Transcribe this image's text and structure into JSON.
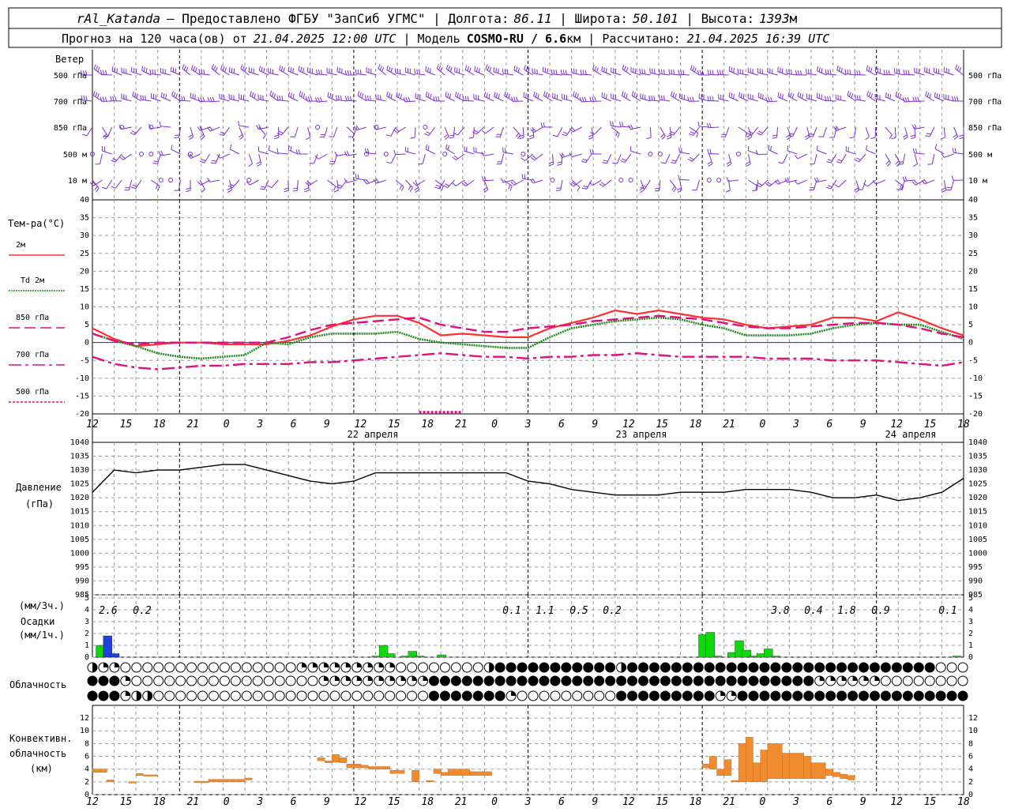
{
  "header": {
    "station": "rAl_Katanda",
    "provider": "— Предоставлено ФГБУ \"ЗапСиб УГМС\"",
    "lon_label": "Долгота:",
    "lon_value": "86.11",
    "lat_label": "Широта:",
    "lat_value": "50.101",
    "alt_label": "Высота:",
    "alt_value": "1393",
    "alt_unit": "м",
    "fc_label": "Прогноз на 120 часа(ов) от",
    "fc_value": "21.04.2025 12:00 UTC",
    "model_label": "Модель",
    "model_value": "COSMO-RU / 6.6",
    "model_unit": "км",
    "calc_label": "Рассчитано:",
    "calc_value": "21.04.2025 16:39 UTC"
  },
  "time_axis": {
    "hours": [
      "12",
      "15",
      "18",
      "21",
      "0",
      "3",
      "6",
      "9",
      "12",
      "15",
      "18",
      "21",
      "0",
      "3",
      "6",
      "9",
      "12",
      "15",
      "18",
      "21",
      "0",
      "3",
      "6",
      "9",
      "12",
      "15",
      "18"
    ],
    "dates": [
      "22 апреля",
      "23 апреля",
      "24 апреля"
    ]
  },
  "wind": {
    "title": "Ветер",
    "levels": [
      "500 гПа",
      "700 гПа",
      "850 гПа",
      "500 м",
      "10  м"
    ]
  },
  "chart_data": [
    {
      "type": "line",
      "title": "Тем-ра(°С)",
      "ylim": [
        -20,
        40
      ],
      "yticks": [
        "40",
        "35",
        "30",
        "25",
        "20",
        "15",
        "10",
        "5",
        "0",
        "-5",
        "-10",
        "-15",
        "-20"
      ],
      "x_hours": [
        0,
        3,
        6,
        9,
        12,
        15,
        18,
        21,
        24,
        27,
        30,
        33,
        36,
        39,
        42,
        45,
        48,
        51,
        54,
        57,
        60,
        63,
        66,
        69,
        72,
        75,
        78,
        81,
        84,
        87,
        90,
        93,
        96,
        99,
        102,
        105,
        108,
        111,
        114,
        117,
        120
      ],
      "series": [
        {
          "name": "2м",
          "color": "#ff3030",
          "style": "solid",
          "values": [
            4,
            1,
            -1,
            -0.5,
            0,
            0,
            -0.5,
            -0.5,
            -0.5,
            0.5,
            2,
            4.5,
            6.5,
            7.5,
            7.5,
            5.5,
            2,
            2.5,
            2,
            1.5,
            1.5,
            4,
            5.5,
            7,
            9,
            8,
            9,
            8,
            7,
            6.5,
            5,
            4,
            4.5,
            5,
            7,
            7,
            6,
            8.5,
            6.5,
            4,
            2
          ]
        },
        {
          "name": "Td 2м",
          "color": "#228b22",
          "style": "dotted",
          "values": [
            2.5,
            0.5,
            -1,
            -3,
            -4,
            -4.5,
            -4,
            -3.5,
            0,
            -0.5,
            1.5,
            2.5,
            2.5,
            2.5,
            3,
            1,
            0,
            -0.5,
            -1,
            -1.5,
            -1.5,
            1.5,
            4,
            5,
            6,
            6.5,
            7,
            6.5,
            5,
            4,
            2,
            2,
            2,
            2.5,
            4,
            5,
            5.5,
            5,
            5,
            3,
            1
          ]
        },
        {
          "name": "850 гПа",
          "color": "#e0107f",
          "style": "longdash",
          "values": [
            2.5,
            0.5,
            -0.5,
            0,
            0,
            0,
            0,
            0,
            0,
            1.5,
            3.5,
            5,
            5.5,
            6,
            6.5,
            7,
            5,
            4,
            3,
            3,
            4,
            4.5,
            5,
            6,
            6.5,
            7,
            7.5,
            7,
            6.5,
            5.5,
            4.5,
            4,
            4,
            4.5,
            5,
            5.5,
            5.5,
            5,
            4,
            2.5,
            1.5
          ]
        },
        {
          "name": "700 гПа",
          "color": "#e0107f",
          "style": "dashdot",
          "values": [
            -4,
            -6,
            -7,
            -7.5,
            -7,
            -6.5,
            -6.5,
            -6,
            -6,
            -6,
            -5.5,
            -5.5,
            -5,
            -4.5,
            -4,
            -3.5,
            -3,
            -3.5,
            -4,
            -4,
            -4.5,
            -4,
            -4,
            -3.5,
            -3.5,
            -3,
            -3.5,
            -4,
            -4,
            -4,
            -4,
            -4.5,
            -4.5,
            -4.5,
            -5,
            -5,
            -5,
            -5.5,
            -6,
            -6.5,
            -5.5
          ]
        },
        {
          "name": "500 гПа",
          "color": "#e0107f",
          "style": "shortdash",
          "values": [
            -20,
            null,
            null,
            null,
            null,
            null,
            null,
            null,
            null,
            null,
            null,
            null,
            null,
            null,
            null,
            -19.5,
            -19.5,
            -19.5,
            null,
            null,
            null,
            null,
            null,
            null,
            null,
            null,
            null,
            null,
            null,
            null,
            null,
            null,
            null,
            null,
            null,
            null,
            null,
            null,
            null,
            null,
            null
          ]
        }
      ]
    },
    {
      "type": "line",
      "title": "Давление",
      "ylabel": "(гПа)",
      "ylim": [
        985,
        1040
      ],
      "yticks": [
        "1040",
        "1035",
        "1030",
        "1025",
        "1020",
        "1015",
        "1010",
        "1005",
        "1000",
        "995",
        "990",
        "985"
      ],
      "x_hours": [
        0,
        3,
        6,
        9,
        12,
        15,
        18,
        21,
        24,
        27,
        30,
        33,
        36,
        39,
        42,
        45,
        48,
        51,
        54,
        57,
        60,
        63,
        66,
        69,
        72,
        75,
        78,
        81,
        84,
        87,
        90,
        93,
        96,
        99,
        102,
        105,
        108,
        111,
        114,
        117,
        120
      ],
      "series": [
        {
          "name": "",
          "color": "#000000",
          "values": [
            1022,
            1030,
            1029,
            1030,
            1030,
            1031,
            1032,
            1032,
            1030,
            1028,
            1026,
            1025,
            1026,
            1029,
            1029,
            1029,
            1029,
            1029,
            1029,
            1029,
            1026,
            1025,
            1023,
            1022,
            1021,
            1021,
            1021,
            1022,
            1022,
            1022,
            1023,
            1023,
            1023,
            1022,
            1020,
            1020,
            1021,
            1019,
            1020,
            1022,
            1027
          ]
        }
      ]
    },
    {
      "type": "bar",
      "title": "Осадки",
      "ylabel": "(мм/3ч.) (мм/1ч.)",
      "ylim": [
        0,
        5
      ],
      "yticks": [
        "5",
        "4",
        "3",
        "2",
        "1",
        "0"
      ],
      "labels_3h": [
        "2.6",
        "0.2",
        "0.1",
        "1.1",
        "0.5",
        "0.2",
        "3.8",
        "0.4",
        "1.8",
        "0.9",
        "0.1"
      ],
      "bars": [
        {
          "hour": 1,
          "value": 0.8,
          "kind": "rain"
        },
        {
          "hour": 1,
          "value": 1.0,
          "kind": "rain_top"
        },
        {
          "hour": 2,
          "value": 1.8,
          "kind": "snow"
        },
        {
          "hour": 3,
          "value": 0.3,
          "kind": "snow"
        },
        {
          "hour": 39,
          "value": 0.1,
          "kind": "rain"
        },
        {
          "hour": 40,
          "value": 1.0,
          "kind": "rain"
        },
        {
          "hour": 41,
          "value": 0.3,
          "kind": "rain"
        },
        {
          "hour": 43,
          "value": 0.1,
          "kind": "rain"
        },
        {
          "hour": 44,
          "value": 0.5,
          "kind": "rain"
        },
        {
          "hour": 45,
          "value": 0.1,
          "kind": "rain"
        },
        {
          "hour": 48,
          "value": 0.2,
          "kind": "rain"
        },
        {
          "hour": 84,
          "value": 1.9,
          "kind": "rain"
        },
        {
          "hour": 85,
          "value": 2.1,
          "kind": "rain"
        },
        {
          "hour": 86,
          "value": 0.1,
          "kind": "rain"
        },
        {
          "hour": 88,
          "value": 0.4,
          "kind": "rain"
        },
        {
          "hour": 89,
          "value": 1.4,
          "kind": "rain"
        },
        {
          "hour": 90,
          "value": 0.6,
          "kind": "rain"
        },
        {
          "hour": 91,
          "value": 0.1,
          "kind": "rain"
        },
        {
          "hour": 92,
          "value": 0.3,
          "kind": "rain"
        },
        {
          "hour": 93,
          "value": 0.7,
          "kind": "rain"
        },
        {
          "hour": 94,
          "value": 0.1,
          "kind": "rain"
        },
        {
          "hour": 119,
          "value": 0.1,
          "kind": "rain"
        }
      ]
    },
    {
      "type": "bar",
      "title": "Конвективн. облачность",
      "ylabel": "(км)",
      "ylim": [
        0,
        13
      ],
      "yticks": [
        "12",
        "10",
        "8",
        "6",
        "4",
        "2",
        "0"
      ],
      "segments": [
        {
          "h0": 0,
          "h1": 2,
          "bottom": 3.5,
          "top": 4
        },
        {
          "h0": 2,
          "h1": 3,
          "bottom": 2,
          "top": 2.3
        },
        {
          "h0": 5,
          "h1": 6,
          "bottom": 1.8,
          "top": 2
        },
        {
          "h0": 6,
          "h1": 7,
          "bottom": 3,
          "top": 3.3
        },
        {
          "h0": 7,
          "h1": 9,
          "bottom": 2.9,
          "top": 3.1
        },
        {
          "h0": 14,
          "h1": 16,
          "bottom": 1.9,
          "top": 2.1
        },
        {
          "h0": 16,
          "h1": 21,
          "bottom": 2,
          "top": 2.4
        },
        {
          "h0": 21,
          "h1": 22,
          "bottom": 2.3,
          "top": 2.6
        },
        {
          "h0": 31,
          "h1": 32,
          "bottom": 5.3,
          "top": 5.8
        },
        {
          "h0": 32,
          "h1": 33,
          "bottom": 5,
          "top": 5.3
        },
        {
          "h0": 33,
          "h1": 34,
          "bottom": 5.1,
          "top": 6.3
        },
        {
          "h0": 34,
          "h1": 35,
          "bottom": 5,
          "top": 5.8
        },
        {
          "h0": 35,
          "h1": 37,
          "bottom": 4.2,
          "top": 4.8
        },
        {
          "h0": 37,
          "h1": 38,
          "bottom": 4.2,
          "top": 4.6
        },
        {
          "h0": 38,
          "h1": 41,
          "bottom": 4,
          "top": 4.4
        },
        {
          "h0": 41,
          "h1": 43,
          "bottom": 3.3,
          "top": 3.8
        },
        {
          "h0": 44,
          "h1": 45,
          "bottom": 2,
          "top": 3.8
        },
        {
          "h0": 46,
          "h1": 47,
          "bottom": 2,
          "top": 2.2
        },
        {
          "h0": 47,
          "h1": 48,
          "bottom": 3.3,
          "top": 4
        },
        {
          "h0": 48,
          "h1": 49,
          "bottom": 3,
          "top": 3.5
        },
        {
          "h0": 49,
          "h1": 52,
          "bottom": 3,
          "top": 4
        },
        {
          "h0": 52,
          "h1": 55,
          "bottom": 3,
          "top": 3.6
        },
        {
          "h0": 84,
          "h1": 85,
          "bottom": 4.2,
          "top": 4.8
        },
        {
          "h0": 85,
          "h1": 86,
          "bottom": 4,
          "top": 6
        },
        {
          "h0": 86,
          "h1": 87,
          "bottom": 3,
          "top": 4
        },
        {
          "h0": 87,
          "h1": 88,
          "bottom": 3,
          "top": 5.5
        },
        {
          "h0": 88,
          "h1": 89,
          "bottom": 2,
          "top": 2.2
        },
        {
          "h0": 89,
          "h1": 90,
          "bottom": 2,
          "top": 8
        },
        {
          "h0": 90,
          "h1": 91,
          "bottom": 2,
          "top": 9
        },
        {
          "h0": 91,
          "h1": 92,
          "bottom": 2,
          "top": 5
        },
        {
          "h0": 92,
          "h1": 93,
          "bottom": 2,
          "top": 7
        },
        {
          "h0": 93,
          "h1": 95,
          "bottom": 2.5,
          "top": 8
        },
        {
          "h0": 95,
          "h1": 96,
          "bottom": 2.5,
          "top": 6.5
        },
        {
          "h0": 96,
          "h1": 98,
          "bottom": 2.5,
          "top": 6.5
        },
        {
          "h0": 98,
          "h1": 99,
          "bottom": 2.5,
          "top": 6
        },
        {
          "h0": 99,
          "h1": 101,
          "bottom": 2.5,
          "top": 5
        },
        {
          "h0": 101,
          "h1": 102,
          "bottom": 3,
          "top": 4
        },
        {
          "h0": 102,
          "h1": 103,
          "bottom": 2.8,
          "top": 3.5
        },
        {
          "h0": 103,
          "h1": 104,
          "bottom": 2.5,
          "top": 3.2
        },
        {
          "h0": 104,
          "h1": 105,
          "bottom": 2.3,
          "top": 3
        }
      ]
    }
  ],
  "cloud_title": "Облачность",
  "cloud_rows": [
    "ooooooooooooooooooooooooooooooooooooooooooooooooooooooooooooooooooooooooooooooooooooo",
    "oooooooooooooooooooooooooooooooooooooooooooooooooooooooooooooooooooooooooooooooooooooo",
    "ooooooooooooooooooooooooooooooooooooooooooooooooooooooooooooooooooooooooooooooooooooo"
  ],
  "cloud_pattern": {
    "low": "hqqtqqoooooooooooooooooooooooooooooooooqoqqqqqqqqqqqqqqqqqoooooooooooooooohffffffffffffffffffffffffhqffffffffffffffffffffffffffffffffffffffffffffffffffffffffffooooooo",
    "mid": "ffffffqoooooooooooooooooooooooooooooooooooqqqqqqqqqqqqqqqqqqqffffffffffffffffffffffffffffffffffffffffffffffffffffffffffffffffffffffoqqqqqqqqqqqqooooooooooooooooo",
    "high": "fffffqhhfhoooooooooooooooooooooooooooooooooooooooooooooooooohffffffffffffffqoooooooooooooooooqffffffffffffffffffqqqfffffffffffffffffffffffffffffffffffffffffff"
  },
  "colors": {
    "wind": "#7b2fd6",
    "t2m": "#ff3030",
    "td": "#228b22",
    "isobar": "#e0107f",
    "pressure": "#000000",
    "rain": "#10d810",
    "snow": "#2040e0",
    "conv": "#f08c30",
    "grid": "#9a9a9a"
  }
}
